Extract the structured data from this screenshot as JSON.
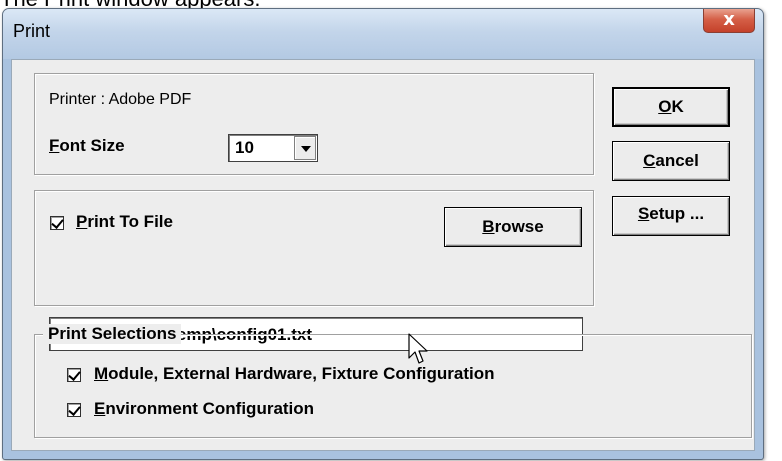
{
  "caption": "The Print window appears.",
  "window": {
    "title": "Print",
    "close_glyph": "x"
  },
  "printer": {
    "label": "Printer : Adobe PDF"
  },
  "font_size": {
    "label_prefix": "F",
    "label_rest": "ont Size",
    "value": "10"
  },
  "buttons": {
    "ok_prefix": "O",
    "ok_rest": "K",
    "cancel_prefix": "C",
    "cancel_rest": "ancel",
    "setup_prefix": "S",
    "setup_rest": "etup ...",
    "browse_prefix": "B",
    "browse_rest": "rowse"
  },
  "print_to_file": {
    "checked": true,
    "label_prefix": "P",
    "label_rest": "rint To File",
    "path": "C:\\CheckSum\\temp\\config01.txt"
  },
  "print_selections": {
    "title": "Print Selections",
    "items": [
      {
        "checked": true,
        "label_prefix": "M",
        "label_rest": "odule, External Hardware,  Fixture Configuration"
      },
      {
        "checked": true,
        "label_prefix": "E",
        "label_rest": "nvironment Configuration"
      }
    ]
  },
  "icons": {
    "close": "close-icon",
    "dropdown": "chevron-down-icon",
    "checkbox": "checkmark-icon",
    "cursor": "mouse-pointer-icon"
  }
}
